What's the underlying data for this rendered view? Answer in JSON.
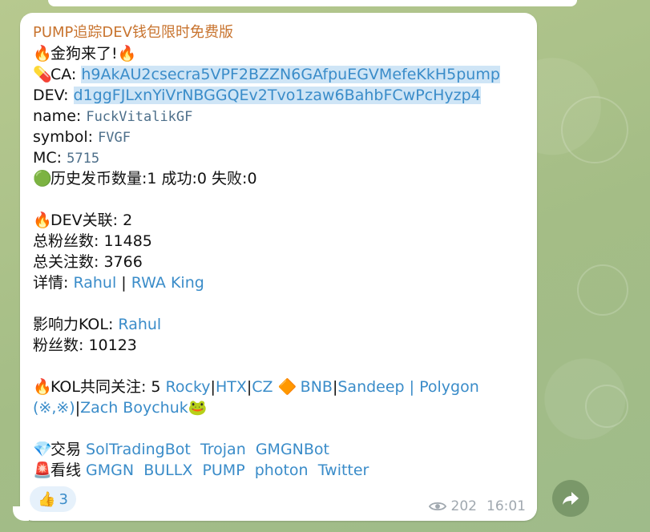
{
  "message": {
    "title": "PUMP追踪DEV钱包限时免费版",
    "headline": "金狗来了!",
    "ca_label": "CA: ",
    "ca_value": "h9AkAU2csecra5VPF2BZZN6GAfpuEGVMefeKkH5pump",
    "dev_label": "DEV: ",
    "dev_value": "d1ggFJLxnYiVrNBGGQEv2Tvo1zaw6BahbFCwPcHyzp4",
    "name_label": "name: ",
    "name_value": "FuckVitalikGF",
    "symbol_label": "symbol: ",
    "symbol_value": "FVGF",
    "mc_label": "MC: ",
    "mc_value": "5715",
    "history": "历史发币数量:1 成功:0 失败:0",
    "dev_link": "DEV关联: 2",
    "total_fans": "总粉丝数: 11485",
    "total_follow": "总关注数: 3766",
    "details_label": "详情: ",
    "details_links": [
      "Rahul",
      "RWA King"
    ],
    "kol_label": "影响力KOL: ",
    "kol_value": "Rahul",
    "kol_fans": "粉丝数: 10123",
    "kol_common_label": "KOL共同关注: 5 ",
    "kol_common_links": [
      "Rocky",
      "HTX",
      "CZ",
      "BNB",
      "Sandeep | Polygon",
      "(※,※)",
      "Zach Boychuk"
    ],
    "trade_label": "交易 ",
    "trade_links": [
      "SolTradingBot",
      "Trojan",
      "GMGNBot"
    ],
    "watch_label": "看线 ",
    "watch_links": [
      "GMGN",
      "BULLX",
      "PUMP",
      "photon",
      "Twitter"
    ]
  },
  "reaction": {
    "emoji": "👍",
    "count": "3"
  },
  "meta": {
    "views": "202",
    "time": "16:01"
  },
  "icons": {
    "fire": "fire-icon",
    "pill": "pill-icon",
    "green_circle": "green-circle-icon",
    "diamond": "orange-diamond-icon",
    "frog": "frog-icon",
    "gem": "gem-icon",
    "siren": "siren-icon",
    "eye": "eye-icon",
    "forward": "forward-icon"
  },
  "colors": {
    "link": "#3a8cc9",
    "title": "#c8742f",
    "selection": "#cfe5f6"
  }
}
